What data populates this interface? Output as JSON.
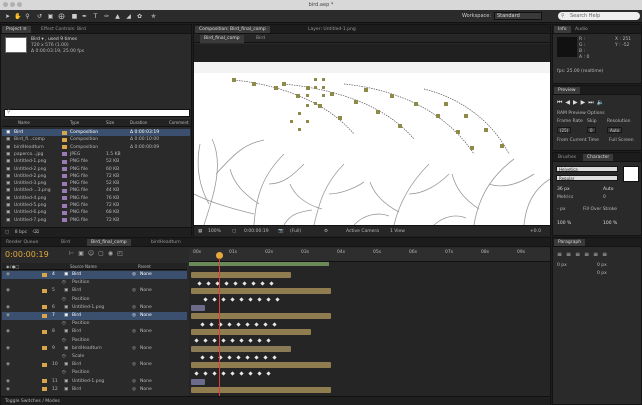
{
  "window": {
    "title": "bird.aep *"
  },
  "toolbar": {
    "workspace_label": "Workspace:",
    "workspace_value": "Standard",
    "search_placeholder": "Search Help"
  },
  "project": {
    "tab_label": "Project ≡",
    "effect_tab": "Effect Controls: Bird",
    "item_name": "Bird ▾ , used 9 times",
    "item_dims": "720 x 576 (1.00)",
    "item_duration": "Δ 0:00:03:19, 25.00 fps",
    "columns": [
      "Name",
      "Type",
      "Size",
      "Duration",
      "Comment"
    ],
    "items": [
      {
        "name": "Bird",
        "type": "Composition",
        "size": "",
        "duration": "Δ 0:00:03:19",
        "selected": true,
        "color": "#d9a54b"
      },
      {
        "name": "Bird_fi...comp",
        "type": "Composition",
        "size": "",
        "duration": "Δ 0:00:10:00",
        "selected": false,
        "color": "#d9a54b"
      },
      {
        "name": "birdHeadturn",
        "type": "Composition",
        "size": "",
        "duration": "Δ 0:00:00:09",
        "selected": false,
        "color": "#d9a54b"
      },
      {
        "name": "paperco...jpg",
        "type": "JPEG",
        "size": "1.5 KB",
        "duration": "",
        "selected": false,
        "color": "#9a7bb5"
      },
      {
        "name": "Untitled-1.png",
        "type": "PNG file",
        "size": "52 KB",
        "duration": "",
        "selected": false,
        "color": "#9a7bb5"
      },
      {
        "name": "Untitled-2.png",
        "type": "PNG file",
        "size": "60 KB",
        "duration": "",
        "selected": false,
        "color": "#9a7bb5"
      },
      {
        "name": "Untitled-2.png",
        "type": "PNG file",
        "size": "72 KB",
        "duration": "",
        "selected": false,
        "color": "#9a7bb5"
      },
      {
        "name": "Untitled-3.png",
        "type": "PNG file",
        "size": "52 KB",
        "duration": "",
        "selected": false,
        "color": "#9a7bb5"
      },
      {
        "name": "Untitled-...3.png",
        "type": "PNG file",
        "size": "44 KB",
        "duration": "",
        "selected": false,
        "color": "#9a7bb5"
      },
      {
        "name": "Untitled-4.png",
        "type": "PNG file",
        "size": "76 KB",
        "duration": "",
        "selected": false,
        "color": "#9a7bb5"
      },
      {
        "name": "Untitled-5.png",
        "type": "PNG file",
        "size": "72 KB",
        "duration": "",
        "selected": false,
        "color": "#9a7bb5"
      },
      {
        "name": "Untitled-6.png",
        "type": "PNG file",
        "size": "68 KB",
        "duration": "",
        "selected": false,
        "color": "#9a7bb5"
      },
      {
        "name": "Untitled-7.png",
        "type": "PNG file",
        "size": "72 KB",
        "duration": "",
        "selected": false,
        "color": "#9a7bb5"
      }
    ],
    "footer": "8 bpc"
  },
  "composition": {
    "tab_label": "Composition: Bird_final_comp",
    "layer_tab": "Layer: Untitled-1.png",
    "subtab_1": "Bird_final_comp",
    "subtab_2": "Bird",
    "footer_zoom": "100%",
    "footer_time": "0:00:00:19",
    "footer_res": "(Full)",
    "footer_camera": "Active Camera",
    "footer_view": "1 View",
    "footer_offset": "+0.0"
  },
  "info": {
    "tab_label": "Info",
    "audio_tab": "Audio",
    "r_label": "R :",
    "g_label": "G :",
    "b_label": "B :",
    "a_label": "A : 0",
    "x_value": "X : 251",
    "y_value": "Y : -52",
    "fps": "fps: 25.00 (realtime)"
  },
  "preview": {
    "tab_label": "Preview",
    "ram_options": "RAM Preview Options",
    "frame_rate": "Frame Rate",
    "skip": "Skip",
    "resolution": "Resolution",
    "frame_rate_value": "(25)",
    "skip_value": "0",
    "resolution_value": "Auto",
    "from_current": "From Current Time",
    "full_screen": "Full Screen"
  },
  "character": {
    "brushes_tab": "Brushes",
    "tab_label": "Character",
    "font": "Helvetica",
    "style": "Regular",
    "size": "36 px",
    "leading": "Auto",
    "kerning": "Metrics",
    "tracking": "0",
    "stroke": "- px",
    "stroke_mode": "Fill Over Stroke",
    "vscale": "100 %",
    "hscale": "100 %"
  },
  "paragraph": {
    "tab_label": "Paragraph",
    "indent_left": "0 px",
    "indent_right": "0 px",
    "space_before": "0 px"
  },
  "timeline": {
    "render_tab": "Render Queue",
    "bird_tab": "Bird",
    "final_tab": "Bird_final_comp",
    "head_tab": "birdHeadturn",
    "timecode": "0:00:00:19",
    "col_source": "Source Name",
    "col_parent": "Parent",
    "ruler": [
      "00s",
      "01s",
      "02s",
      "03s",
      "04s",
      "05s",
      "06s",
      "07s",
      "08s",
      "09s"
    ],
    "layers": [
      {
        "num": "4",
        "name": "Bird",
        "parent": "None",
        "selected": true
      },
      {
        "num": "",
        "name": "Position",
        "parent": "",
        "selected": false
      },
      {
        "num": "5",
        "name": "Bird",
        "parent": "None",
        "selected": false
      },
      {
        "num": "",
        "name": "Position",
        "parent": "",
        "selected": false
      },
      {
        "num": "6",
        "name": "Untitled-1.png",
        "parent": "None",
        "selected": false
      },
      {
        "num": "7",
        "name": "Bird",
        "parent": "None",
        "selected": true
      },
      {
        "num": "",
        "name": "Position",
        "parent": "",
        "selected": false
      },
      {
        "num": "8",
        "name": "Bird",
        "parent": "None",
        "selected": false
      },
      {
        "num": "",
        "name": "Position",
        "parent": "",
        "selected": false
      },
      {
        "num": "9",
        "name": "birdHeadturn",
        "parent": "None",
        "selected": false
      },
      {
        "num": "",
        "name": "Scale",
        "parent": "",
        "selected": false
      },
      {
        "num": "10",
        "name": "Bird",
        "parent": "None",
        "selected": false
      },
      {
        "num": "",
        "name": "Position",
        "parent": "",
        "selected": false
      },
      {
        "num": "11",
        "name": "Untitled-1.png",
        "parent": "None",
        "selected": false
      },
      {
        "num": "12",
        "name": "Bird",
        "parent": "None",
        "selected": false
      }
    ],
    "footer": "Toggle Switches / Modes"
  }
}
